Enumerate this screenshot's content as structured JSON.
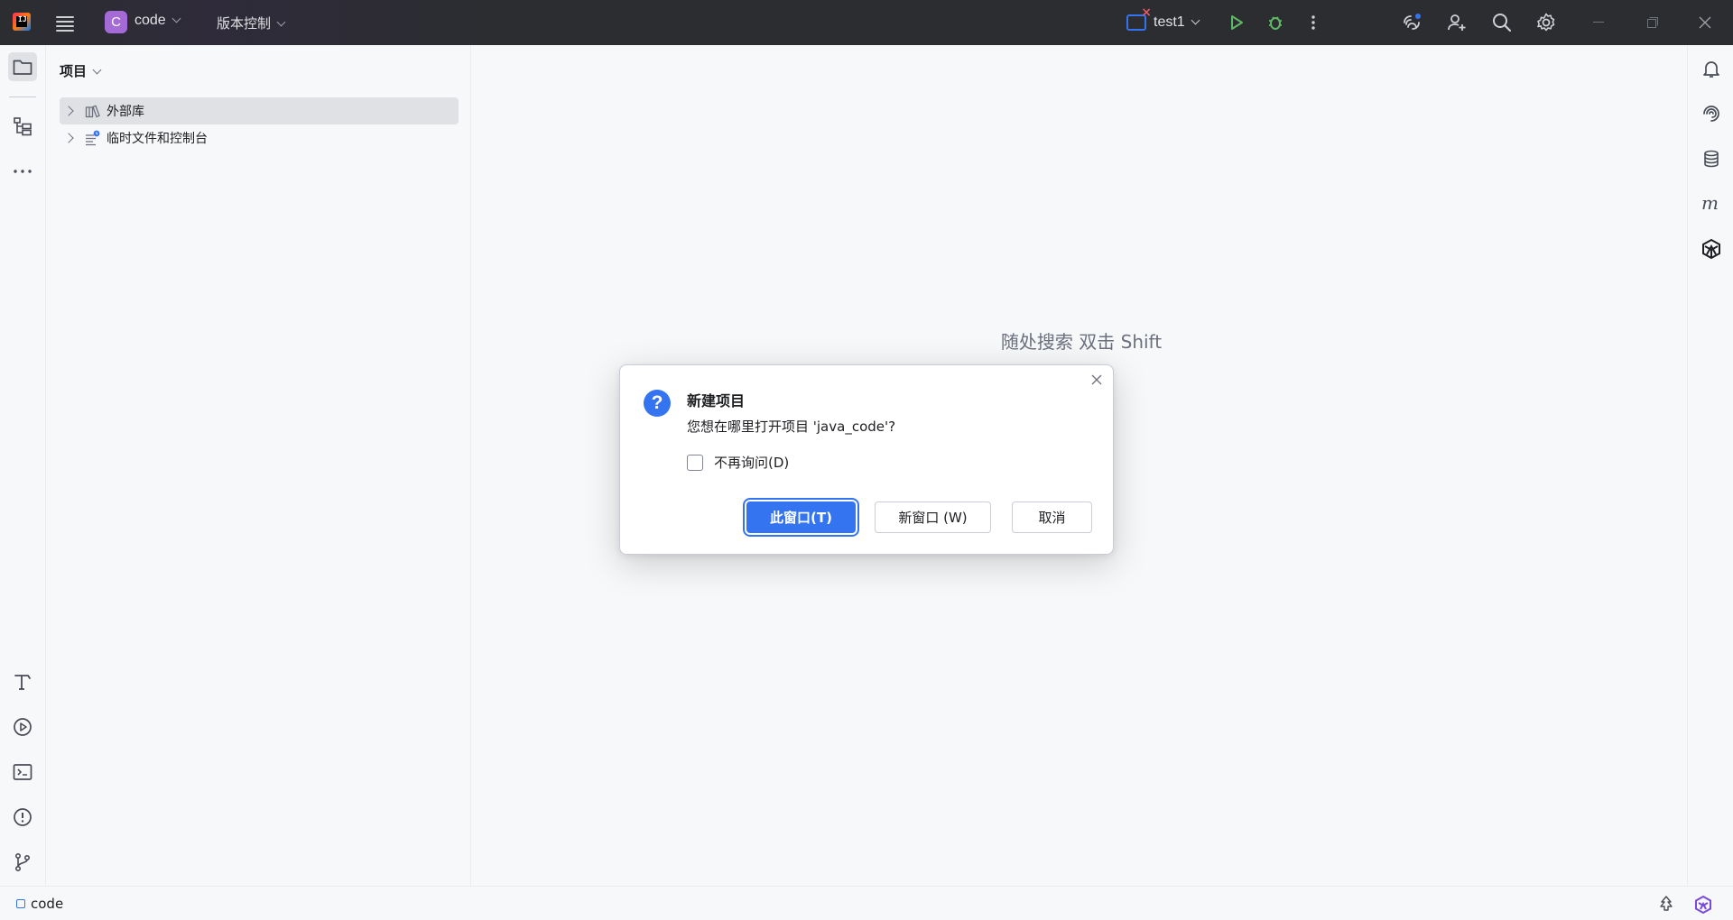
{
  "titlebar": {
    "project_badge": "C",
    "project_name": "code",
    "vcs_label": "版本控制",
    "run_config": "test1"
  },
  "icons": {
    "app_logo_text": "IJ"
  },
  "project_panel": {
    "title": "项目",
    "tree": [
      {
        "label": "外部库",
        "icon": "library-icon",
        "selected": true
      },
      {
        "label": "临时文件和控制台",
        "icon": "scratches-icon",
        "selected": false
      }
    ]
  },
  "editor": {
    "hint": "随处搜索 双击 Shift"
  },
  "dialog": {
    "title": "新建项目",
    "message": "您想在哪里打开项目 'java_code'?",
    "checkbox_label": "不再询问(D)",
    "btn_this_window": "此窗口(T)",
    "btn_new_window": "新窗口 (W)",
    "btn_cancel": "取消"
  },
  "statusbar": {
    "crumb": "code"
  },
  "colors": {
    "titlebar_bg": "#2b2d30",
    "accent": "#3574f0",
    "project_badge": "#a46ad6",
    "run_green": "#5fb865",
    "panel_bg": "#f7f8fa"
  }
}
